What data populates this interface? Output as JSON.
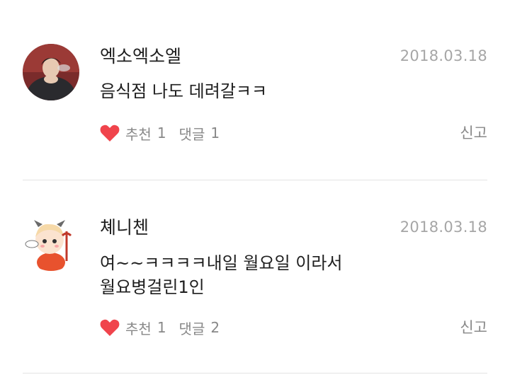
{
  "comments": [
    {
      "author": "엑소엑소엘",
      "date": "2018.03.18",
      "text": "음식점 나도 데려갈ㅋㅋ",
      "recommend_label": "추천",
      "recommend_count": "1",
      "reply_label": "댓글",
      "reply_count": "1",
      "report_label": "신고",
      "avatar_icon": "user-photo-avatar"
    },
    {
      "author": "쳬니첸",
      "date": "2018.03.18",
      "text": "여~~ㅋㅋㅋㅋ내일 월요일 이라서\n월요병걸린1인",
      "recommend_label": "추천",
      "recommend_count": "1",
      "reply_label": "댓글",
      "reply_count": "2",
      "report_label": "신고",
      "avatar_icon": "cartoon-devil-avatar"
    }
  ],
  "colors": {
    "heart": "#f0444c",
    "meta_text": "#888888",
    "date_text": "#a6a6a6",
    "divider": "#e4e4e4"
  }
}
